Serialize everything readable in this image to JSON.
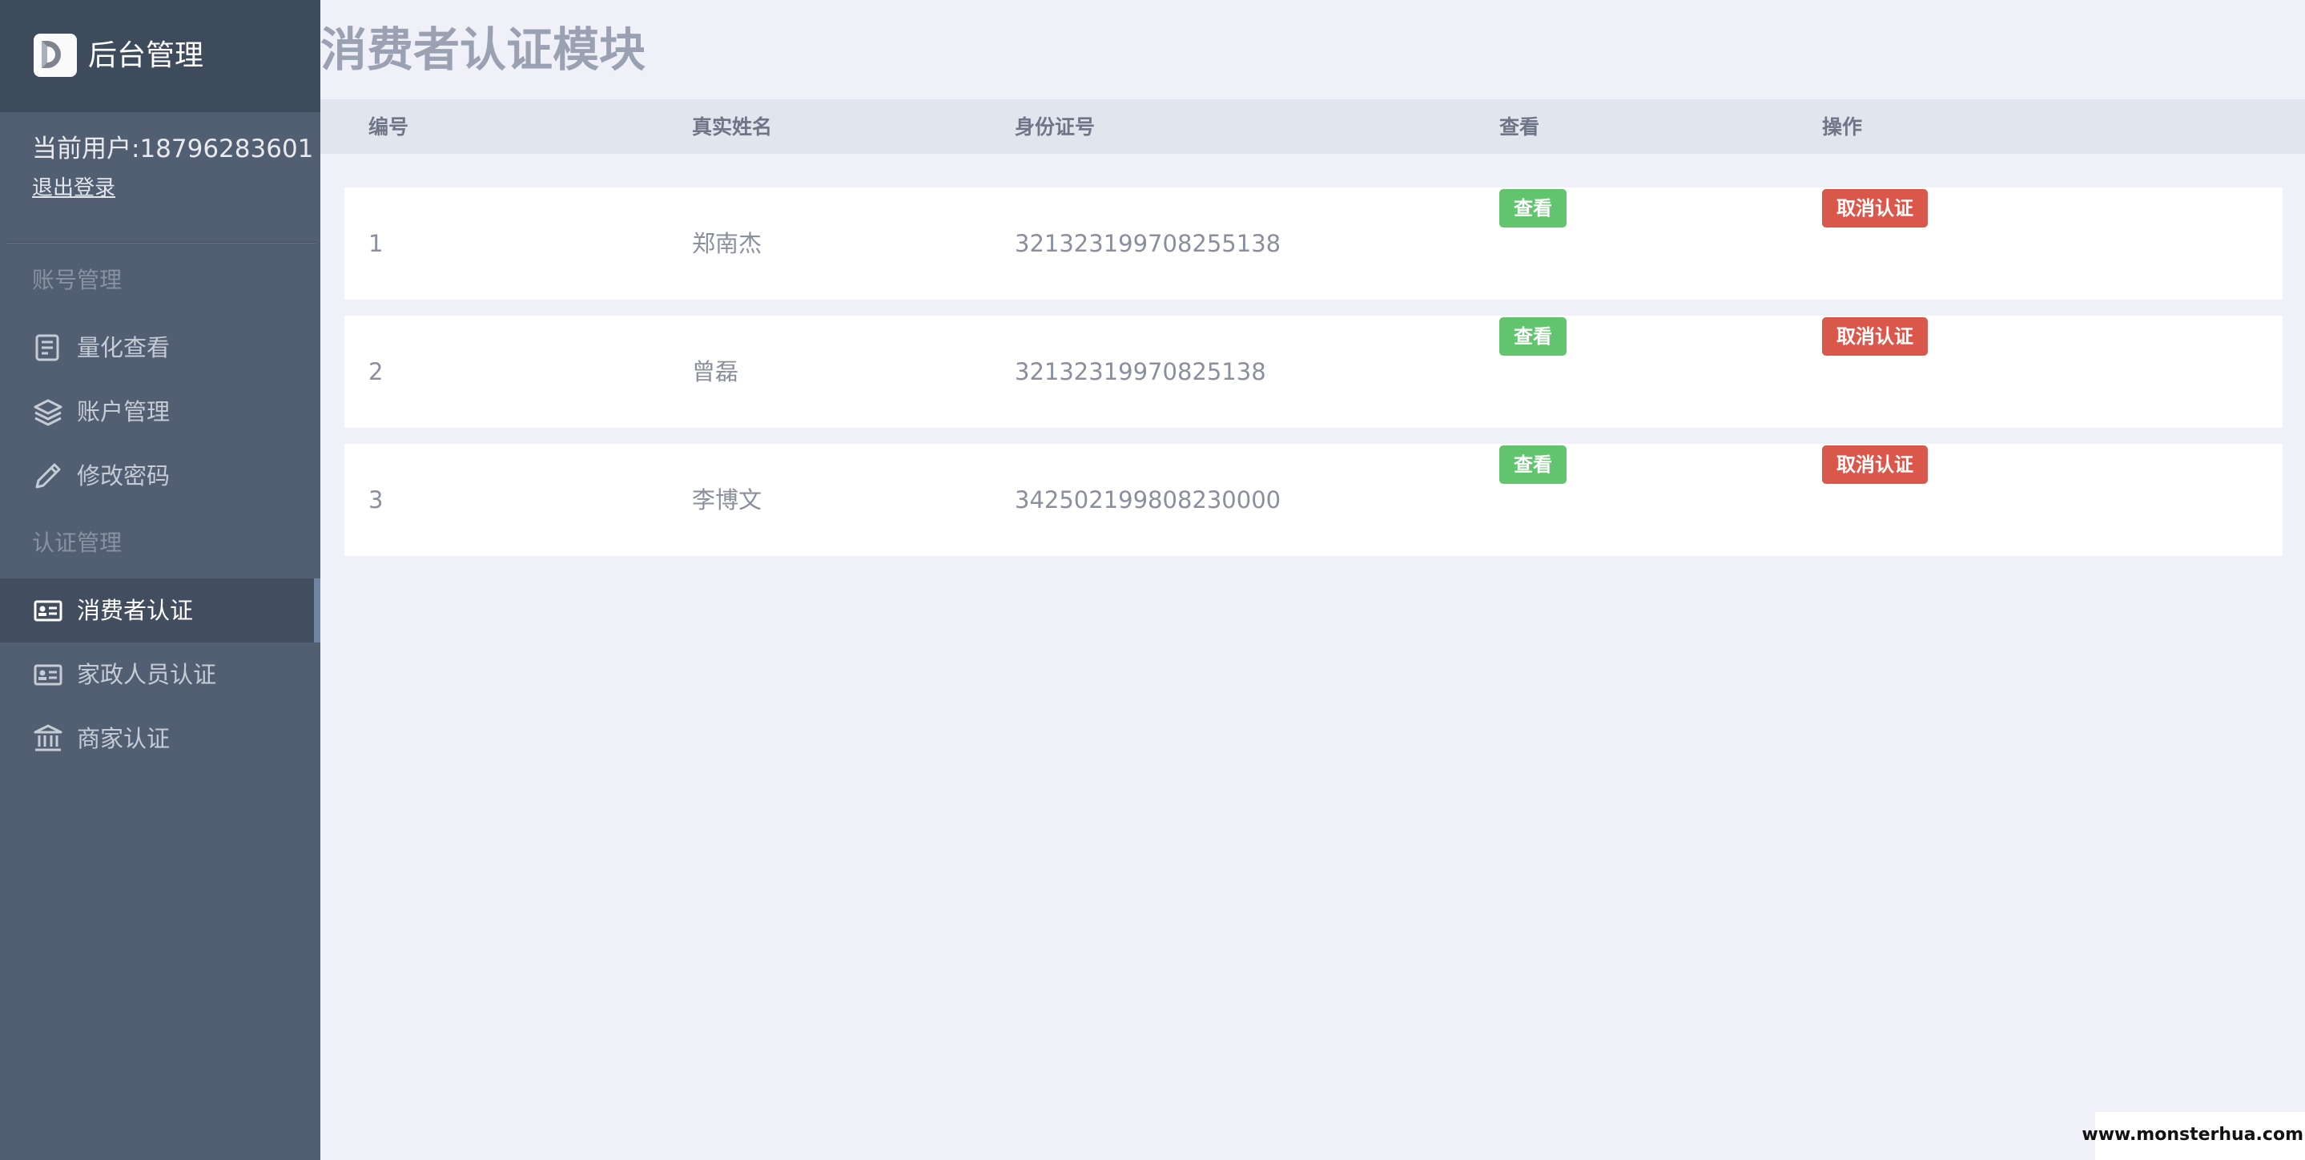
{
  "brand": {
    "title": "后台管理",
    "logo_icon": "d-logo-icon"
  },
  "user": {
    "current_label": "当前用户:18796283601",
    "logout_label": "退出登录"
  },
  "sidebar": {
    "groups": [
      {
        "title": "账号管理"
      },
      {
        "title": "认证管理"
      }
    ],
    "items": [
      {
        "label": "量化查看",
        "icon": "document-list-icon"
      },
      {
        "label": "账户管理",
        "icon": "layers-icon"
      },
      {
        "label": "修改密码",
        "icon": "pencil-icon"
      },
      {
        "label": "消费者认证",
        "icon": "id-card-icon",
        "active": true
      },
      {
        "label": "家政人员认证",
        "icon": "id-card-icon"
      },
      {
        "label": "商家认证",
        "icon": "bank-icon"
      }
    ]
  },
  "main": {
    "title": "消费者认证模块",
    "columns": [
      "编号",
      "真实姓名",
      "身份证号",
      "查看",
      "操作"
    ],
    "rows": [
      {
        "id": "1",
        "name": "郑南杰",
        "id_number": "321323199708255138",
        "view_label": "查看",
        "action_label": "取消认证"
      },
      {
        "id": "2",
        "name": "曾磊",
        "id_number": "32132319970825138",
        "view_label": "查看",
        "action_label": "取消认证"
      },
      {
        "id": "3",
        "name": "李博文",
        "id_number": "342502199808230000",
        "view_label": "查看",
        "action_label": "取消认证"
      }
    ]
  },
  "colors": {
    "sidebar": "#525f72",
    "brand_bar": "#3e4b5d",
    "view_button": "#63c46f",
    "cancel_button": "#d9574b"
  },
  "watermark": "www.monsterhua.com"
}
